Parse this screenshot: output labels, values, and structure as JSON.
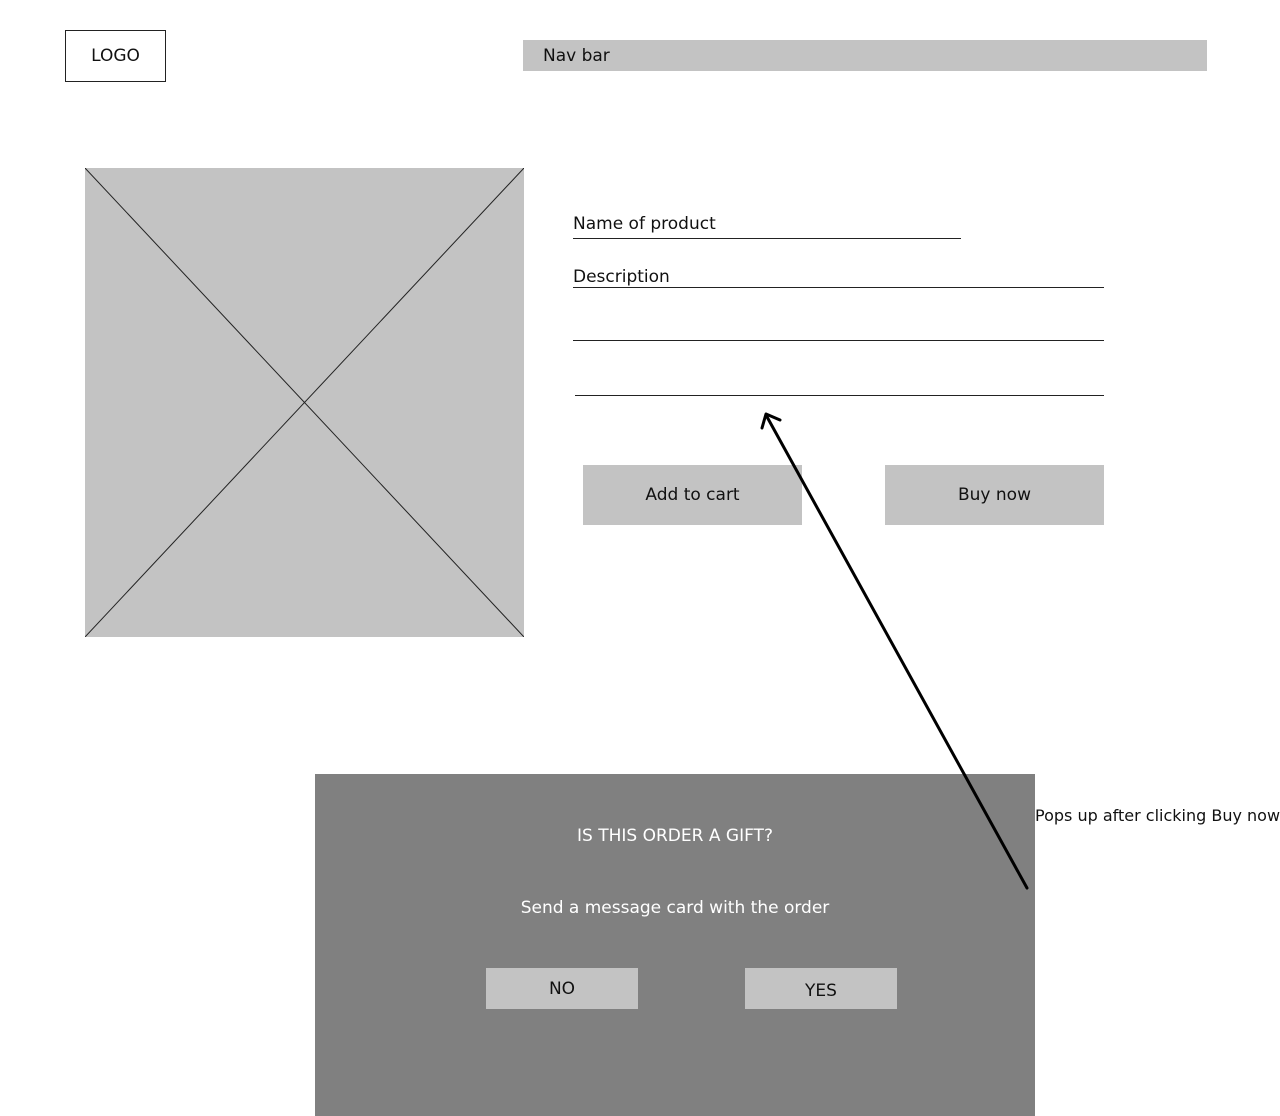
{
  "header": {
    "logo_label": "LOGO",
    "nav_label": "Nav bar"
  },
  "product": {
    "name_label": "Name of product",
    "description_label": "Description",
    "add_to_cart_label": "Add to cart",
    "buy_now_label": "Buy now"
  },
  "modal": {
    "title": "IS THIS ORDER A GIFT?",
    "subtitle": "Send a message card with the order",
    "no_label": "NO",
    "yes_label": "YES"
  },
  "annotation": {
    "text": "Pops up after clicking Buy now"
  },
  "colors": {
    "placeholder_gray": "#c3c3c3",
    "modal_gray": "#808080"
  }
}
